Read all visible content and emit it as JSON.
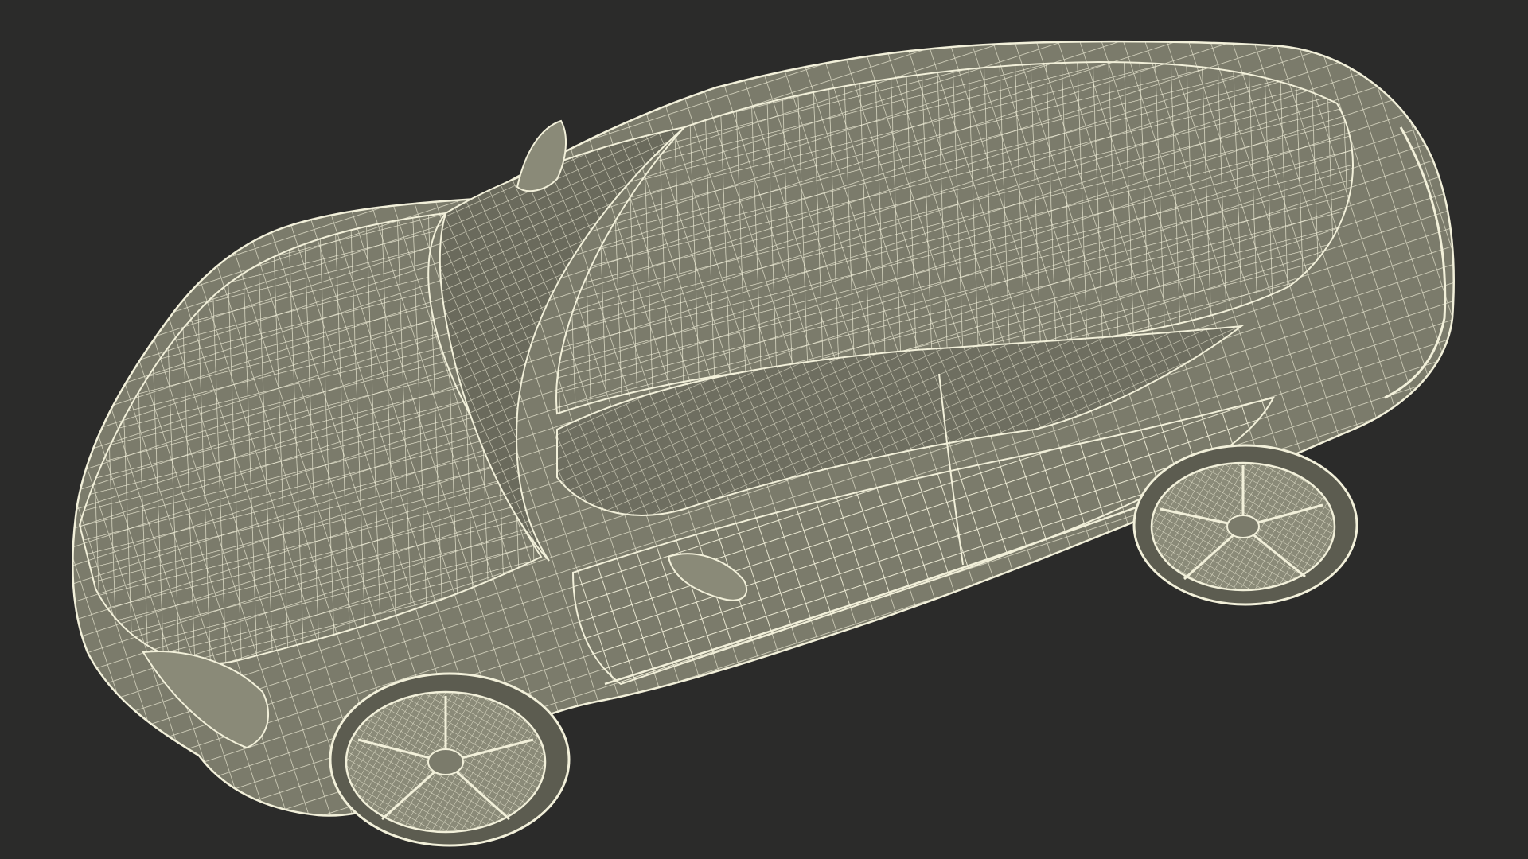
{
  "scene": {
    "background_color": "#2b2b2a",
    "model_fill_color": "#7b7b6b",
    "model_shadow_color": "#5c5c50",
    "wire_color": "#f2f0da",
    "wheel_fill_color": "#8a8a78",
    "render_mode": "wireframe-over-shaded"
  }
}
